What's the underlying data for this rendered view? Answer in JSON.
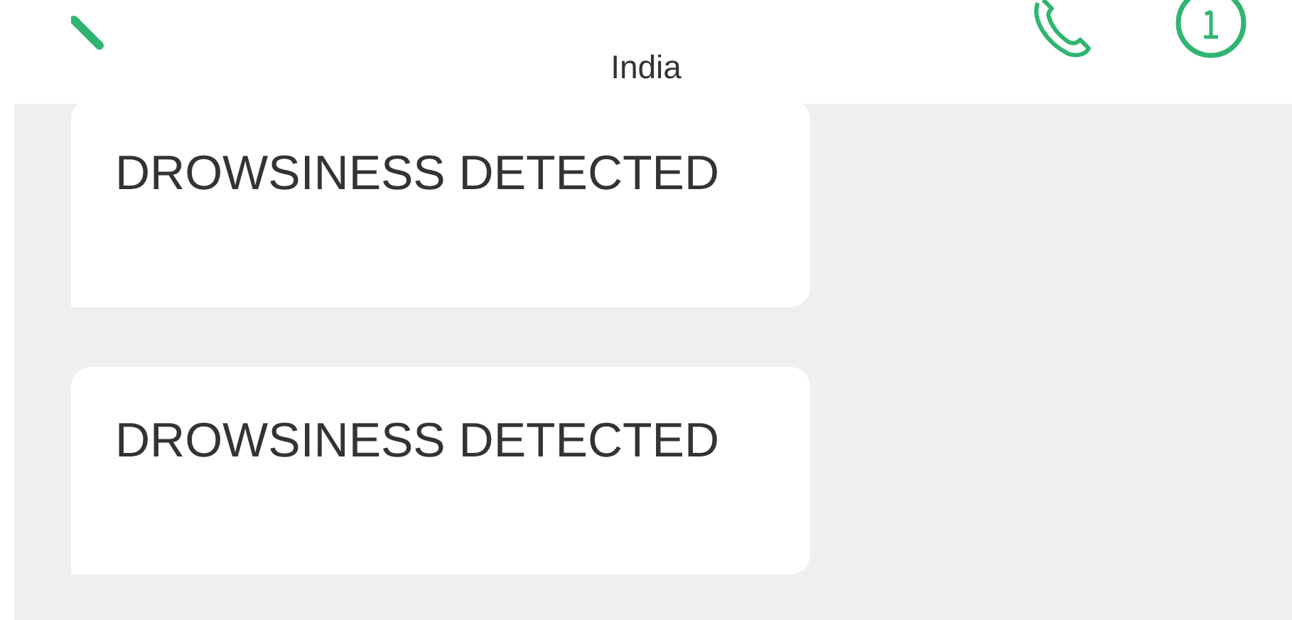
{
  "header": {
    "subtitle": "India"
  },
  "messages": [
    {
      "text": "DROWSINESS DETECTED"
    },
    {
      "text": "DROWSINESS DETECTED"
    }
  ]
}
